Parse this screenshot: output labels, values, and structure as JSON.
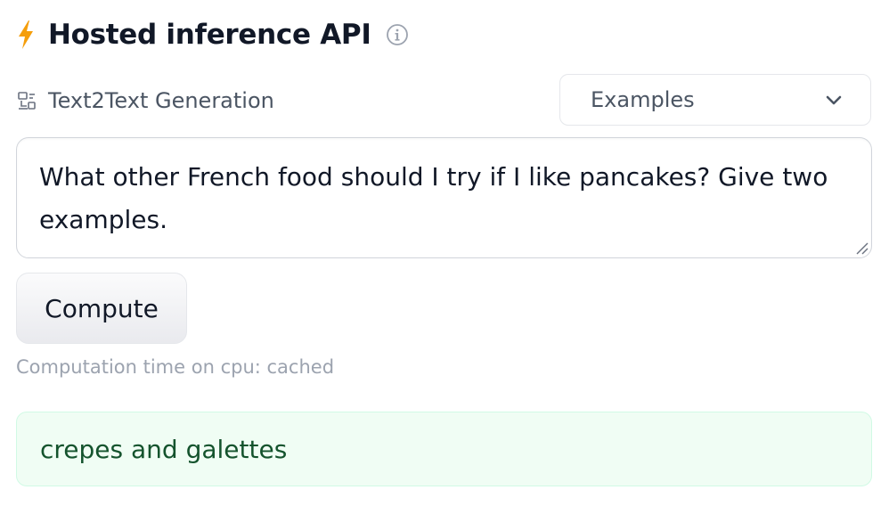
{
  "header": {
    "title": "Hosted inference API",
    "bolt_icon": "lightning-bolt-icon",
    "info_icon": "info-circle-icon",
    "accent_color": "#f59e0b"
  },
  "task": {
    "icon": "text2text-icon",
    "label": "Text2Text Generation"
  },
  "examples_dropdown": {
    "label": "Examples",
    "icon": "chevron-down-icon"
  },
  "input": {
    "value": "What other French food should I try if I like pancakes? Give two examples."
  },
  "compute_button": {
    "label": "Compute"
  },
  "status": {
    "computation_time": "Computation time on cpu: cached"
  },
  "output": {
    "text": "crepes and galettes",
    "background_color": "#f0fdf4"
  }
}
